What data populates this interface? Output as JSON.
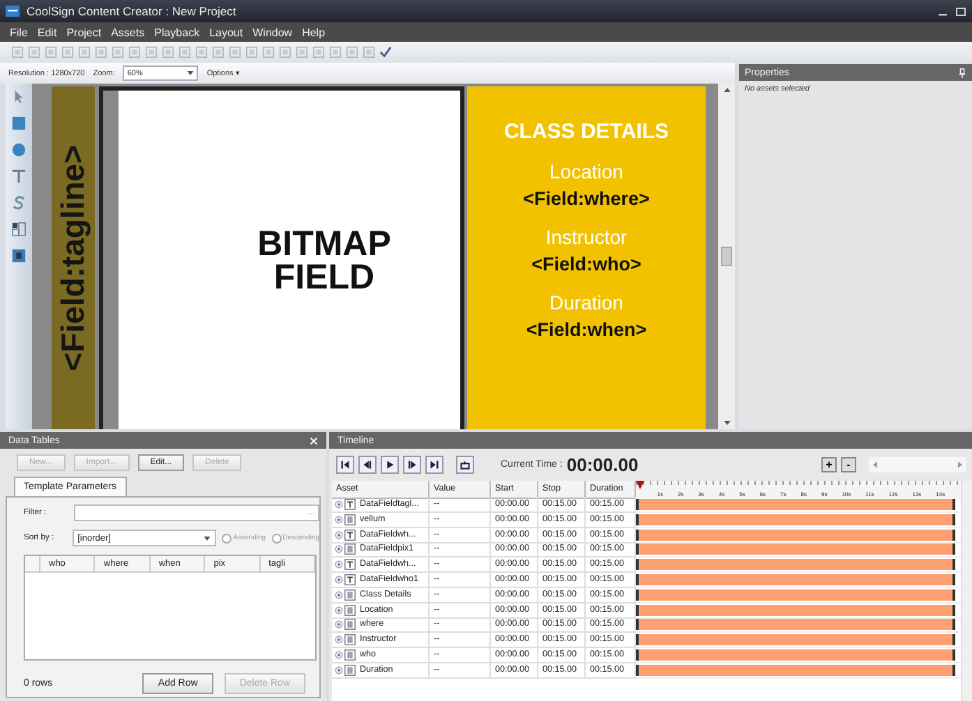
{
  "window": {
    "title": "CoolSign Content Creator : New Project"
  },
  "menu": [
    "File",
    "Edit",
    "Project",
    "Assets",
    "Playback",
    "Layout",
    "Window",
    "Help"
  ],
  "options_bar": {
    "resolution": "Resolution : 1280x720",
    "zoom_label": "Zoom:",
    "zoom_value": "60%",
    "options": "Options ▾"
  },
  "canvas": {
    "tagline": "<Field:tagline>",
    "bitmap": [
      "BITMAP",
      "FIELD"
    ],
    "heading": "CLASS DETAILS",
    "sections": [
      {
        "label": "Location",
        "field": "<Field:where>"
      },
      {
        "label": "Instructor",
        "field": "<Field:who>"
      },
      {
        "label": "Duration",
        "field": "<Field:when>"
      }
    ]
  },
  "properties": {
    "title": "Properties",
    "empty_text": "No assets selected"
  },
  "data_tables": {
    "title": "Data Tables",
    "buttons": [
      {
        "label": "New...",
        "disabled": true
      },
      {
        "label": "Import...",
        "disabled": true
      },
      {
        "label": "Edit...",
        "disabled": false
      },
      {
        "label": "Delete",
        "disabled": true
      }
    ],
    "tabs": [
      {
        "label": "Template Parameters",
        "selected": true
      }
    ],
    "filter_label": "Filter :",
    "filter_button": "...",
    "sort_label": "Sort by :",
    "sort_value": "[inorder]",
    "sort_order": [
      {
        "label": "Ascending",
        "selected": false
      },
      {
        "label": "Descending",
        "selected": false
      }
    ],
    "columns": [
      "who",
      "where",
      "when",
      "pix",
      "tagli"
    ],
    "row_count": "0 rows",
    "actions": [
      {
        "label": "Add Row",
        "disabled": false
      },
      {
        "label": "Delete Row",
        "disabled": true
      }
    ]
  },
  "timeline": {
    "title": "Timeline",
    "current_time_label": "Current Time :",
    "current_time": "00:00.00",
    "zoom_buttons": [
      "+",
      "-"
    ],
    "columns": [
      "Asset",
      "Value",
      "Start",
      "Stop",
      "Duration"
    ],
    "ruler": [
      "1s",
      "2s",
      "3s",
      "4s",
      "5s",
      "6s",
      "7s",
      "8s",
      "9s",
      "10s",
      "11s",
      "12s",
      "13s",
      "14s"
    ],
    "rows": [
      {
        "kind": "text",
        "asset": "DataFieldtagl...",
        "value": "--",
        "start": "00:00.00",
        "stop": "00:15.00",
        "duration": "00:15.00"
      },
      {
        "kind": "table",
        "asset": "vellum",
        "value": "--",
        "start": "00:00.00",
        "stop": "00:15.00",
        "duration": "00:15.00"
      },
      {
        "kind": "text",
        "asset": "DataFieldwh...",
        "value": "--",
        "start": "00:00.00",
        "stop": "00:15.00",
        "duration": "00:15.00"
      },
      {
        "kind": "table",
        "asset": "DataFieldpix1",
        "value": "--",
        "start": "00:00.00",
        "stop": "00:15.00",
        "duration": "00:15.00"
      },
      {
        "kind": "text",
        "asset": "DataFieldwh...",
        "value": "--",
        "start": "00:00.00",
        "stop": "00:15.00",
        "duration": "00:15.00"
      },
      {
        "kind": "text",
        "asset": "DataFieldwho1",
        "value": "--",
        "start": "00:00.00",
        "stop": "00:15.00",
        "duration": "00:15.00"
      },
      {
        "kind": "table",
        "asset": "Class Details",
        "value": "--",
        "start": "00:00.00",
        "stop": "00:15.00",
        "duration": "00:15.00"
      },
      {
        "kind": "table",
        "asset": "Location",
        "value": "--",
        "start": "00:00.00",
        "stop": "00:15.00",
        "duration": "00:15.00"
      },
      {
        "kind": "table",
        "asset": "where",
        "value": "--",
        "start": "00:00.00",
        "stop": "00:15.00",
        "duration": "00:15.00"
      },
      {
        "kind": "table",
        "asset": "Instructor",
        "value": "--",
        "start": "00:00.00",
        "stop": "00:15.00",
        "duration": "00:15.00"
      },
      {
        "kind": "table",
        "asset": "who",
        "value": "--",
        "start": "00:00.00",
        "stop": "00:15.00",
        "duration": "00:15.00"
      },
      {
        "kind": "table",
        "asset": "Duration",
        "value": "--",
        "start": "00:00.00",
        "stop": "00:15.00",
        "duration": "00:15.00"
      }
    ]
  }
}
